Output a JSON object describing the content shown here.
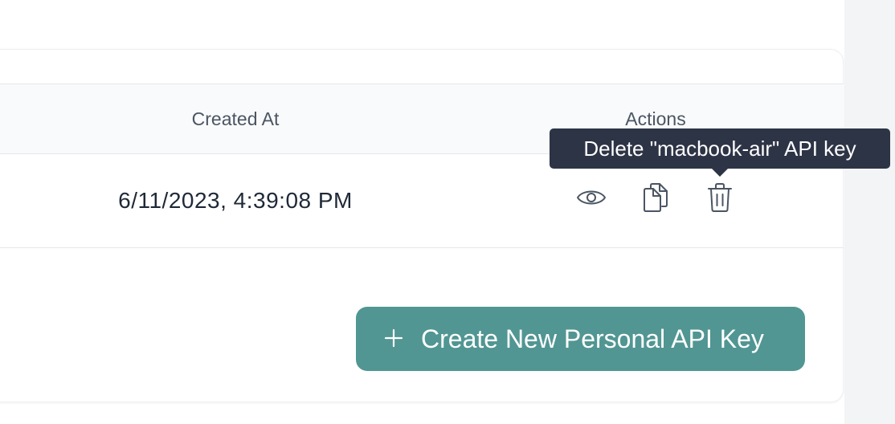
{
  "table": {
    "columns": {
      "created_at": "Created At",
      "actions": "Actions"
    },
    "rows": [
      {
        "created_at": "6/11/2023, 4:39:08 PM",
        "actions": [
          "view-icon",
          "copy-icon",
          "delete-icon"
        ]
      }
    ]
  },
  "tooltip": {
    "text": "Delete \"macbook-air\" API key"
  },
  "create_button": {
    "icon": "plus-icon",
    "label": "Create New Personal API Key"
  },
  "colors": {
    "primary": "#519693",
    "tooltip_bg": "#2d3446",
    "header_bg": "#f9fafb",
    "text_muted": "#4b5563",
    "text_dark": "#1f2937"
  }
}
